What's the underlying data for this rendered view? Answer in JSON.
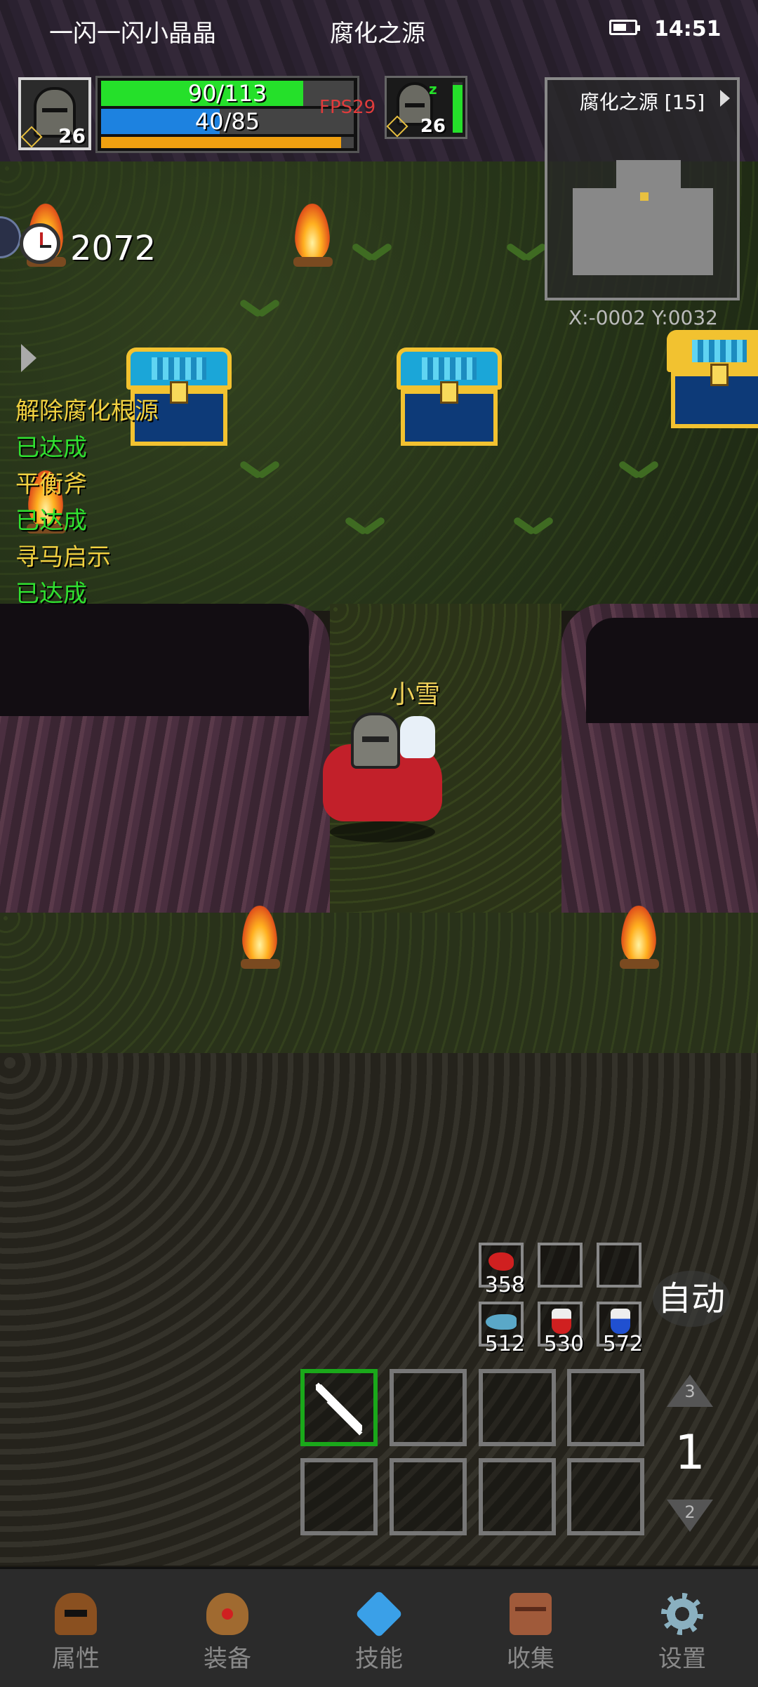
{
  "status_bar": {
    "carrier": "一闪一闪小晶晶",
    "location": "腐化之源",
    "time": "14:51"
  },
  "player": {
    "level": "26",
    "hp_text": "90/113",
    "hp_fraction": 0.8,
    "mp_text": "40/85",
    "mp_fraction": 0.47,
    "xp_fraction": 0.95,
    "name": "小雪"
  },
  "fps": "FPS29",
  "pet": {
    "level": "26",
    "hp_fraction": 0.95
  },
  "minimap": {
    "title": "腐化之源 [15]",
    "coords": "X:-0002  Y:0032"
  },
  "timer": "2072",
  "quests": [
    {
      "name": "解除腐化根源",
      "status": "已达成"
    },
    {
      "name": "平衡斧",
      "status": "已达成"
    },
    {
      "name": "寻马启示",
      "status": "已达成"
    }
  ],
  "quick_items": [
    {
      "icon": "meat-icon",
      "count": "358"
    },
    {
      "icon": "",
      "count": ""
    },
    {
      "icon": "",
      "count": ""
    },
    {
      "icon": "fish-icon",
      "count": "512"
    },
    {
      "icon": "potion-red-icon",
      "count": "530"
    },
    {
      "icon": "potion-blue-icon",
      "count": "572"
    }
  ],
  "auto_label": "自动",
  "skill_page": {
    "up": "3",
    "current": "1",
    "down": "2"
  },
  "skill_slots": [
    "arrows-icon",
    "",
    "",
    "",
    "",
    "",
    "",
    ""
  ],
  "bottom_nav": [
    {
      "label": "属性",
      "icon": "helmet-icon"
    },
    {
      "label": "装备",
      "icon": "bag-icon"
    },
    {
      "label": "技能",
      "icon": "gem-icon"
    },
    {
      "label": "收集",
      "icon": "book-icon"
    },
    {
      "label": "设置",
      "icon": "gear-icon"
    }
  ],
  "colors": {
    "hp": "#25e02a",
    "mp": "#1d82e0",
    "xp": "#f0a010",
    "quest_name": "#f0d040",
    "quest_done": "#30e030"
  }
}
